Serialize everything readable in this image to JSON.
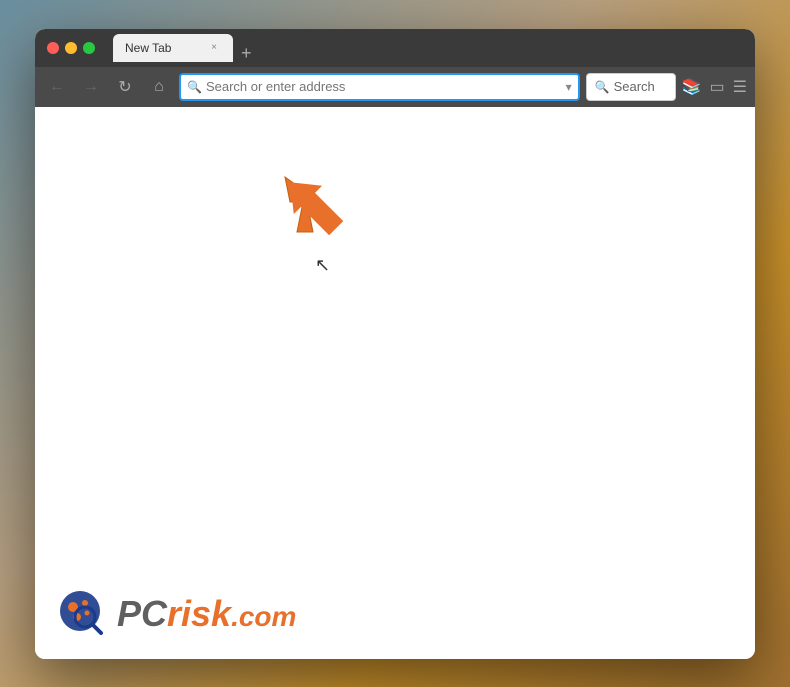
{
  "browser": {
    "title": "New Tab",
    "tab_close": "×",
    "new_tab_btn": "+",
    "address_placeholder": "Search or enter address",
    "search_label": "Search",
    "nav": {
      "back": "←",
      "forward": "→",
      "refresh": "↻",
      "home": "⌂"
    }
  },
  "watermark": {
    "pc_text": "PC",
    "risk_text": "risk",
    "dot_com": ".com"
  },
  "colors": {
    "close": "#ff5f57",
    "minimize": "#ffbc2e",
    "maximize": "#28c840",
    "arrow": "#e8702a",
    "address_border": "#2196F3"
  }
}
